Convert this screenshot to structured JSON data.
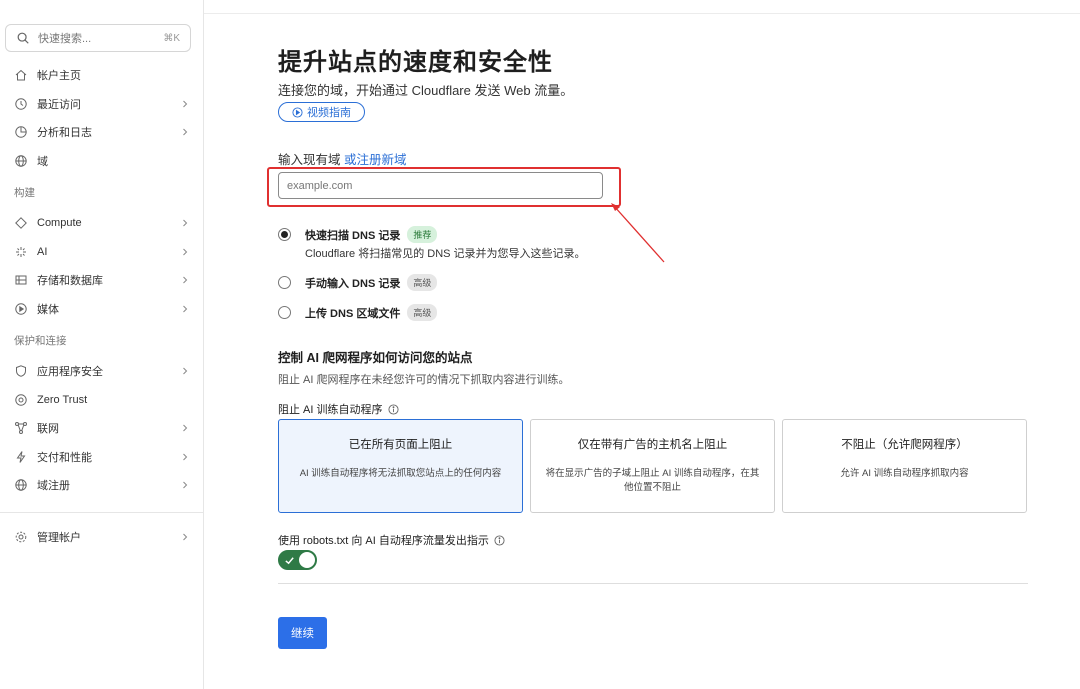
{
  "search": {
    "placeholder": "快速搜索...",
    "shortcut": "⌘K"
  },
  "sidebar": {
    "items_a": [
      {
        "label": "帐户主页",
        "icon": "home-icon",
        "chevron": false
      },
      {
        "label": "最近访问",
        "icon": "clock-icon",
        "chevron": true
      },
      {
        "label": "分析和日志",
        "icon": "chart-icon",
        "chevron": true
      },
      {
        "label": "域",
        "icon": "globe-icon",
        "chevron": false
      }
    ],
    "section_build": "构建",
    "items_b": [
      {
        "label": "Compute",
        "icon": "compute-icon",
        "chevron": true
      },
      {
        "label": "AI",
        "icon": "sparkle-icon",
        "chevron": true
      },
      {
        "label": "存储和数据库",
        "icon": "storage-icon",
        "chevron": true
      },
      {
        "label": "媒体",
        "icon": "play-icon",
        "chevron": true
      }
    ],
    "section_protect": "保护和连接",
    "items_c": [
      {
        "label": "应用程序安全",
        "icon": "shield-icon",
        "chevron": true
      },
      {
        "label": "Zero Trust",
        "icon": "zero-trust-icon",
        "chevron": false
      },
      {
        "label": "联网",
        "icon": "network-icon",
        "chevron": true
      },
      {
        "label": "交付和性能",
        "icon": "bolt-icon",
        "chevron": true
      },
      {
        "label": "域注册",
        "icon": "globe-icon",
        "chevron": true
      }
    ],
    "items_d": [
      {
        "label": "管理帐户",
        "icon": "gear-icon",
        "chevron": true
      }
    ]
  },
  "main": {
    "title": "提升站点的速度和安全性",
    "subtitle": "连接您的域，开始通过 Cloudflare 发送 Web 流量。",
    "video_button": "视频指南",
    "field_label": "输入现有域",
    "field_link": "或注册新域",
    "domain_placeholder": "example.com",
    "options": [
      {
        "label": "快速扫描 DNS 记录",
        "badge": "推荐",
        "selected": true
      },
      {
        "label": "手动输入 DNS 记录",
        "badge": "高级",
        "selected": false
      },
      {
        "label": "上传 DNS 区域文件",
        "badge": "高级",
        "selected": false
      }
    ],
    "option_desc": "Cloudflare 将扫描常见的 DNS 记录并为您导入这些记录。",
    "ai_title": "控制 AI 爬网程序如何访问您的站点",
    "ai_desc": "阻止 AI 爬网程序在未经您许可的情况下抓取内容进行训练。",
    "block_label": "阻止 AI 训练自动程序",
    "cards": [
      {
        "title": "已在所有页面上阻止",
        "desc": "AI 训练自动程序将无法抓取您站点上的任何内容",
        "selected": true
      },
      {
        "title": "仅在带有广告的主机名上阻止",
        "desc": "将在显示广告的子域上阻止 AI 训练自动程序，在其他位置不阻止",
        "selected": false
      },
      {
        "title": "不阻止（允许爬网程序）",
        "desc": "允许 AI 训练自动程序抓取内容",
        "selected": false
      }
    ],
    "robots_label": "使用 robots.txt 向 AI 自动程序流量发出指示",
    "robots_enabled": true,
    "continue_button": "继续"
  },
  "colors": {
    "accent": "#2c6fe8",
    "link": "#2b6fd6",
    "toggle_on": "#2f7a46",
    "highlight": "#e03030"
  }
}
